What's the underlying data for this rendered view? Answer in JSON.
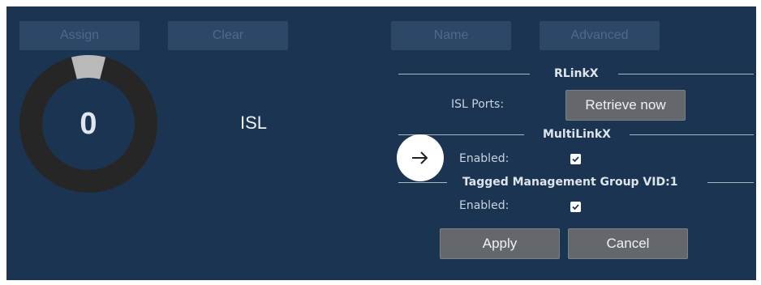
{
  "toolbar": {
    "assign_label": "Assign",
    "clear_label": "Clear",
    "name_label": "Name",
    "advanced_label": "Advanced"
  },
  "gauge": {
    "value": "0",
    "fill_fraction": 0.08
  },
  "main": {
    "title": "ISL"
  },
  "rlinkx": {
    "section_title": "RLinkX",
    "isl_ports_label": "ISL Ports:",
    "retrieve_label": "Retrieve now"
  },
  "multilinkx": {
    "section_title": "MultiLinkX",
    "enabled_label": "Enabled:",
    "enabled": true
  },
  "tagged_mgmt": {
    "section_title": "Tagged Management Group VID:1",
    "enabled_label": "Enabled:",
    "enabled": true
  },
  "actions": {
    "apply_label": "Apply",
    "cancel_label": "Cancel"
  },
  "colors": {
    "panel_bg": "#1b3452",
    "gauge_track": "#262626",
    "gauge_fill": "#b9b9b9",
    "button_gray": "#64686d",
    "button_disabled": "#2d4866"
  },
  "icons": {
    "pointer": "arrow-right-icon",
    "check": "check-icon"
  }
}
